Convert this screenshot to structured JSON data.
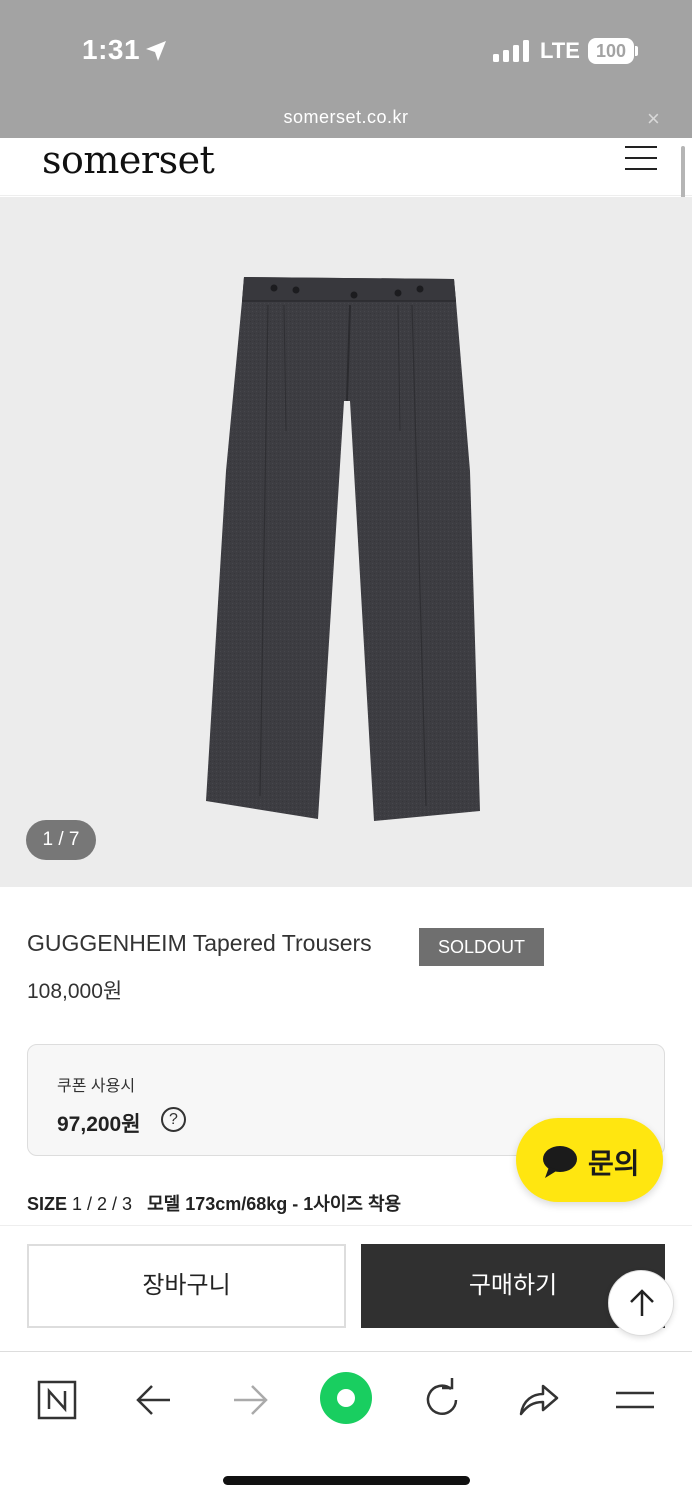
{
  "status_bar": {
    "time": "1:31",
    "network": "LTE",
    "battery": "100"
  },
  "browser": {
    "url": "somerset.co.kr",
    "close_symbol": "×"
  },
  "site": {
    "logo": "somerset"
  },
  "gallery": {
    "counter": "1 / 7",
    "current_image": 1,
    "total_images": 7
  },
  "product": {
    "name": "GUGGENHEIM Tapered Trousers",
    "badge": "SOLDOUT",
    "price": "108,000원",
    "coupon_label": "쿠폰 사용시",
    "coupon_price": "97,200원",
    "help_symbol": "?",
    "size_label": "SIZE",
    "sizes": "1 / 2 / 3",
    "model_info": "모델 173cm/68kg - 1사이즈 착용"
  },
  "inquiry": {
    "label": "문의"
  },
  "actions": {
    "cart": "장바구니",
    "buy": "구매하기"
  },
  "toolbar": {
    "items": [
      "naver-icon",
      "back-icon",
      "forward-icon",
      "green-dot-icon",
      "reload-icon",
      "share-icon",
      "menu-icon"
    ]
  },
  "colors": {
    "status_bg": "#a3a3a3",
    "gallery_bg": "#ececec",
    "trousers": "#3d3d42",
    "sold_badge": "#6f6f6f",
    "buy_button": "#303030",
    "inquiry_yellow": "#ffe610",
    "toolbar_green": "#19ce60"
  }
}
